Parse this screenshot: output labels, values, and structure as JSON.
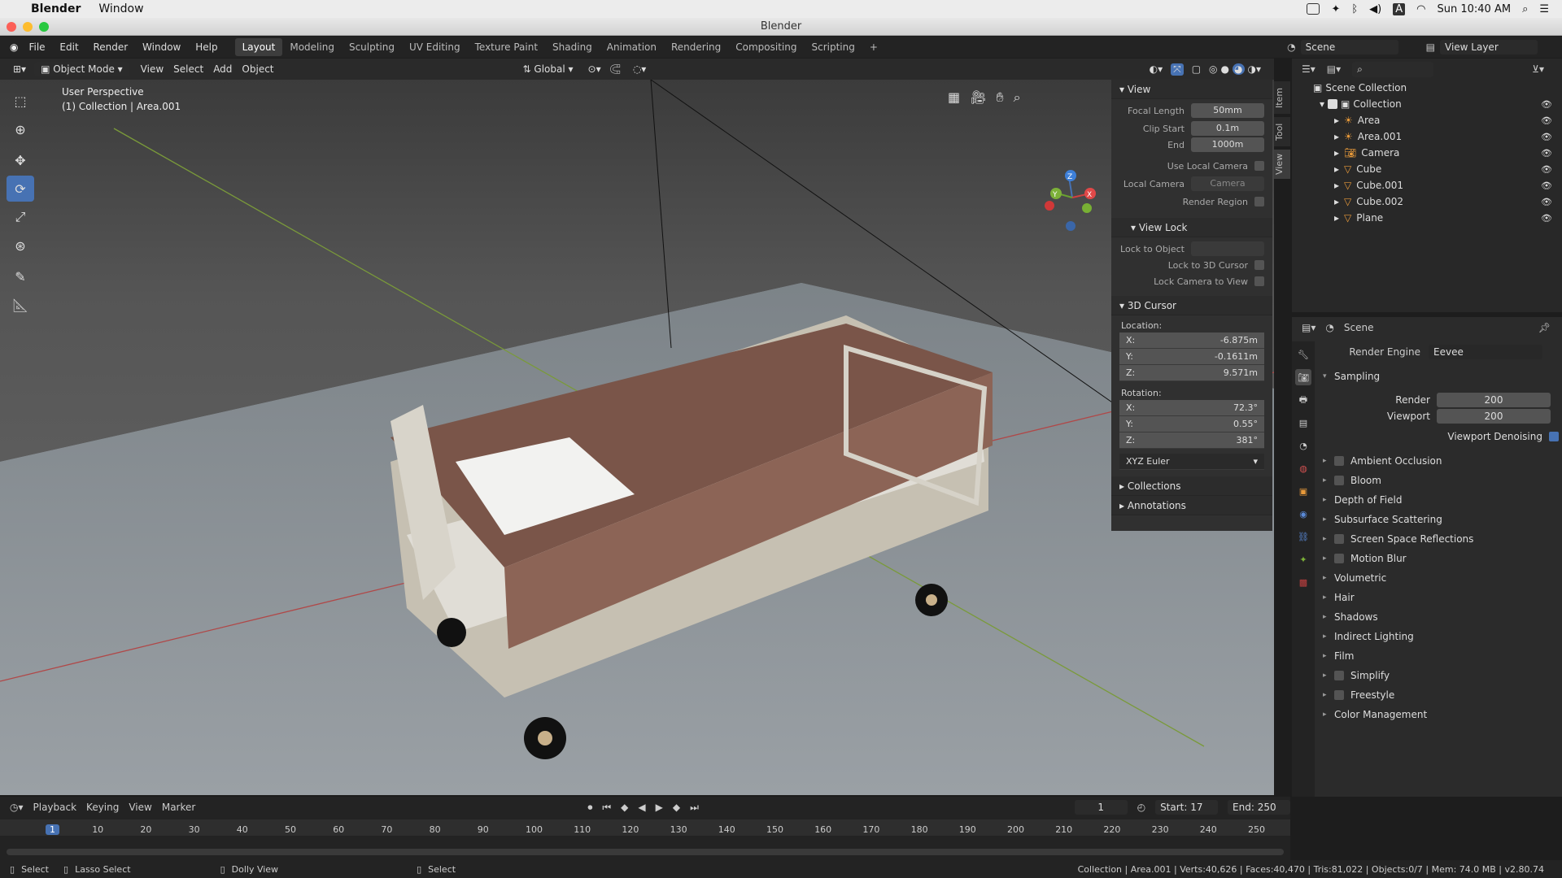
{
  "macmenu": {
    "app": "Blender",
    "window": "Window",
    "clock": "Sun 10:40 AM"
  },
  "title": "Blender",
  "topmenu": [
    "File",
    "Edit",
    "Render",
    "Window",
    "Help"
  ],
  "workspaces": [
    "Layout",
    "Modeling",
    "Sculpting",
    "UV Editing",
    "Texture Paint",
    "Shading",
    "Animation",
    "Rendering",
    "Compositing",
    "Scripting"
  ],
  "scene": "Scene",
  "view_layer": "View Layer",
  "header": {
    "mode": "Object Mode",
    "menus": [
      "View",
      "Select",
      "Add",
      "Object"
    ],
    "orientation": "Global"
  },
  "viewport": {
    "line1": "User Perspective",
    "line2": "(1) Collection | Area.001"
  },
  "npanel": {
    "view": "View",
    "focal_length_label": "Focal Length",
    "focal_length": "50mm",
    "clip_start_label": "Clip Start",
    "clip_start": "0.1m",
    "end_label": "End",
    "end": "1000m",
    "use_local_camera": "Use Local Camera",
    "local_camera_label": "Local Camera",
    "local_camera": "Camera",
    "render_region": "Render Region",
    "view_lock": "View Lock",
    "lock_to_object": "Lock to Object",
    "lock_3d_cursor": "Lock to 3D Cursor",
    "lock_camera": "Lock Camera to View",
    "cursor": "3D Cursor",
    "location": "Location:",
    "rotation": "Rotation:",
    "loc": [
      {
        "axis": "X:",
        "v": "-6.875m"
      },
      {
        "axis": "Y:",
        "v": "-0.1611m"
      },
      {
        "axis": "Z:",
        "v": "9.571m"
      }
    ],
    "rot": [
      {
        "axis": "X:",
        "v": "72.3°"
      },
      {
        "axis": "Y:",
        "v": "0.55°"
      },
      {
        "axis": "Z:",
        "v": "381°"
      }
    ],
    "euler": "XYZ Euler",
    "collections": "Collections",
    "annotations": "Annotations",
    "tabs": [
      "Item",
      "Tool",
      "View"
    ]
  },
  "outliner": {
    "root": "Scene Collection",
    "collection": "Collection",
    "items": [
      "Area",
      "Area.001",
      "Camera",
      "Cube",
      "Cube.001",
      "Cube.002",
      "Plane"
    ]
  },
  "props": {
    "scene": "Scene",
    "render_engine_label": "Render Engine",
    "render_engine": "Eevee",
    "sampling": "Sampling",
    "render_label": "Render",
    "render": "200",
    "viewport_label": "Viewport",
    "viewport": "200",
    "denoise": "Viewport Denoising",
    "sections": [
      {
        "label": "Ambient Occlusion",
        "cb": true
      },
      {
        "label": "Bloom",
        "cb": true
      },
      {
        "label": "Depth of Field",
        "cb": false
      },
      {
        "label": "Subsurface Scattering",
        "cb": false
      },
      {
        "label": "Screen Space Reflections",
        "cb": true
      },
      {
        "label": "Motion Blur",
        "cb": true
      },
      {
        "label": "Volumetric",
        "cb": false
      },
      {
        "label": "Hair",
        "cb": false
      },
      {
        "label": "Shadows",
        "cb": false
      },
      {
        "label": "Indirect Lighting",
        "cb": false
      },
      {
        "label": "Film",
        "cb": false
      },
      {
        "label": "Simplify",
        "cb": true
      },
      {
        "label": "Freestyle",
        "cb": true
      },
      {
        "label": "Color Management",
        "cb": false
      }
    ]
  },
  "timeline": {
    "menus": [
      "Playback",
      "Keying",
      "View",
      "Marker"
    ],
    "frame": "1",
    "start_label": "Start:",
    "start": "17",
    "end_label": "End:",
    "end": "250",
    "ticks": [
      "1",
      "10",
      "20",
      "30",
      "40",
      "50",
      "60",
      "70",
      "80",
      "90",
      "100",
      "110",
      "120",
      "130",
      "140",
      "150",
      "160",
      "170",
      "180",
      "190",
      "200",
      "210",
      "220",
      "230",
      "240",
      "250"
    ]
  },
  "status": {
    "select": "Select",
    "lasso": "Lasso Select",
    "dolly": "Dolly View",
    "select2": "Select",
    "info": "Collection | Area.001 | Verts:40,626 | Faces:40,470 | Tris:81,022 | Objects:0/7 | Mem: 74.0 MB | v2.80.74"
  }
}
